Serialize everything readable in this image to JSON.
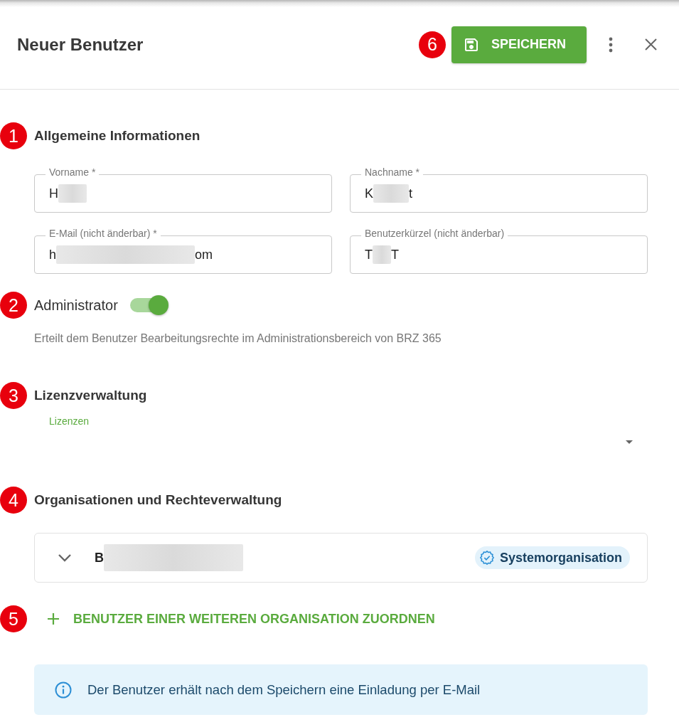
{
  "header": {
    "title": "Neuer Benutzer",
    "marker": "6",
    "save_button": {
      "label": "SPEICHERN"
    }
  },
  "general": {
    "marker": "1",
    "heading": "Allgemeine Informationen",
    "fields": [
      {
        "label": "Vorname *",
        "value": [
          {
            "kind": "text",
            "text": "H"
          },
          {
            "kind": "redacted"
          }
        ]
      },
      {
        "label": "Nachname *",
        "value": [
          {
            "kind": "text",
            "text": "K"
          },
          {
            "kind": "redacted"
          },
          {
            "kind": "text",
            "text": "t"
          }
        ]
      },
      {
        "label": "E-Mail (nicht änderbar) *",
        "value": [
          {
            "kind": "text",
            "text": "h"
          },
          {
            "kind": "redacted"
          },
          {
            "kind": "text",
            "text": "om"
          }
        ]
      },
      {
        "label": "Benutzerkürzel (nicht änderbar)",
        "value": [
          {
            "kind": "text",
            "text": "T"
          },
          {
            "kind": "redacted"
          },
          {
            "kind": "text",
            "text": "T"
          }
        ]
      }
    ]
  },
  "administrator": {
    "marker": "2",
    "label": "Administrator",
    "on": true,
    "description": "Erteilt dem Benutzer Bearbeitungsrechte im Administrationsbereich von BRZ 365"
  },
  "licenses": {
    "marker": "3",
    "heading": "Lizenzverwaltung",
    "select": {
      "label": "Lizenzen",
      "focused": true
    }
  },
  "organizations": {
    "marker": "4",
    "heading": "Organisationen und Rechteverwaltung",
    "items": [
      {
        "expanded": false,
        "name": [
          {
            "kind": "text",
            "text": "B"
          },
          {
            "kind": "redacted"
          }
        ],
        "badge": "Systemorganisation"
      }
    ]
  },
  "add_organization": {
    "marker": "5",
    "label": "BENUTZER EINER WEITEREN ORGANISATION ZUORDNEN"
  },
  "info": {
    "text": "Der Benutzer erhält nach dem Speichern eine Einladung per E-Mail"
  }
}
